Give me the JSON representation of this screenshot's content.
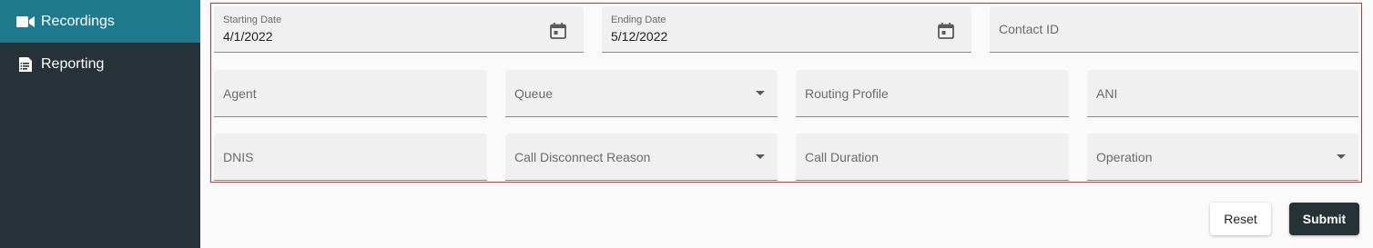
{
  "sidebar": {
    "items": [
      {
        "label": "Recordings",
        "icon": "video-camera-icon",
        "active": true
      },
      {
        "label": "Reporting",
        "icon": "report-document-icon",
        "active": false
      }
    ]
  },
  "filters": {
    "starting_date": {
      "label": "Starting Date",
      "value": "4/1/2022"
    },
    "ending_date": {
      "label": "Ending Date",
      "value": "5/12/2022"
    },
    "contact_id": {
      "label": "Contact ID"
    },
    "agent": {
      "label": "Agent"
    },
    "queue": {
      "label": "Queue"
    },
    "routing_profile": {
      "label": "Routing Profile"
    },
    "ani": {
      "label": "ANI"
    },
    "dnis": {
      "label": "DNIS"
    },
    "call_disconnect_reason": {
      "label": "Call Disconnect Reason"
    },
    "call_duration": {
      "label": "Call Duration"
    },
    "operation": {
      "label": "Operation"
    }
  },
  "actions": {
    "reset_label": "Reset",
    "submit_label": "Submit"
  },
  "colors": {
    "sidebar_bg": "#263238",
    "active_item_bg": "#1e7a8c",
    "highlight_border": "#d32f2f",
    "submit_bg": "#263238"
  }
}
